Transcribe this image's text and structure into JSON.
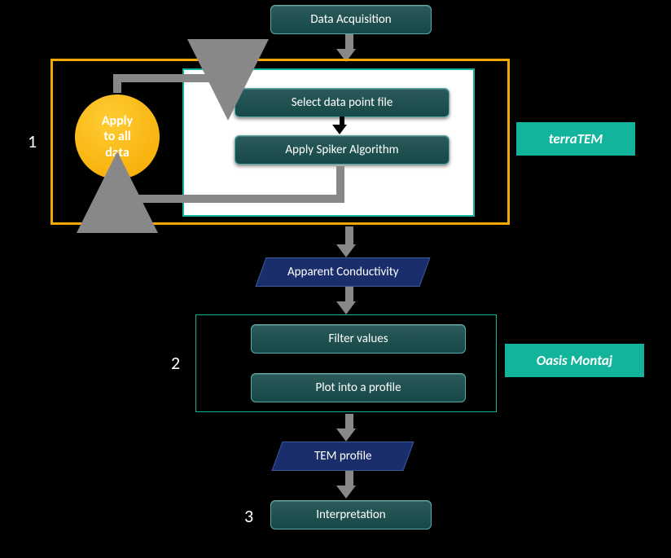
{
  "top": {
    "data_acq": "Data Acquisition"
  },
  "stage1": {
    "num": "1",
    "select": "Select data point file",
    "apply_spiker": "Apply Spiker Algorithm",
    "apply_all": "Apply\nto all\ndata",
    "tool": "terraTEM"
  },
  "mid": {
    "apparent": "Apparent Conductivity"
  },
  "stage2": {
    "num": "2",
    "filter": "Filter values",
    "plot": "Plot into a profile",
    "tool": "Oasis Montaj"
  },
  "tem": "TEM profile",
  "stage3": {
    "num": "3",
    "interp": "Interpretation"
  }
}
